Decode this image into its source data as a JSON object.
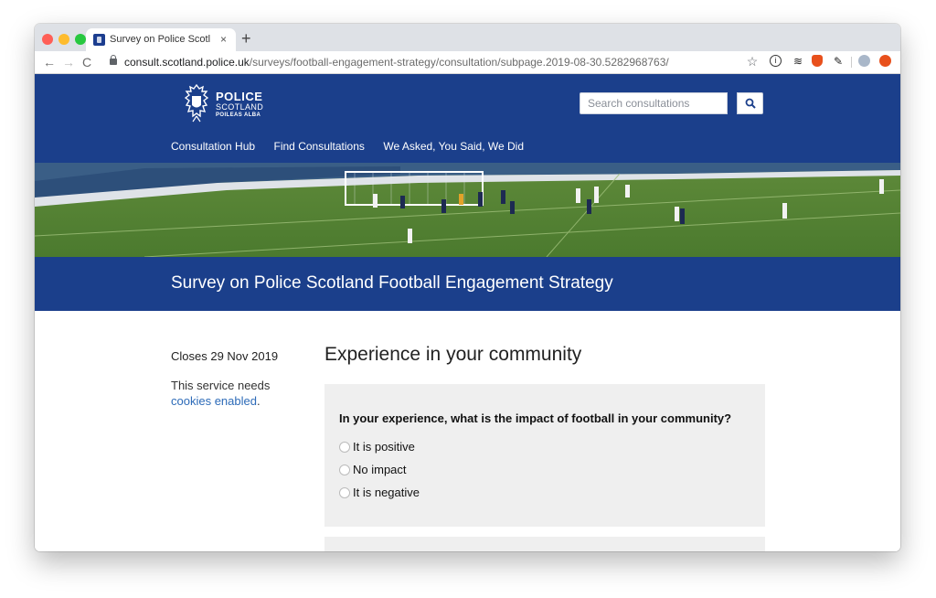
{
  "browser": {
    "tab_title": "Survey on Police Scotland Foot",
    "tab_close": "×",
    "new_tab": "+",
    "url_host": "consult.scotland.police.uk",
    "url_path": "/surveys/football-engagement-strategy/consultation/subpage.2019-08-30.5282968763/",
    "nav": {
      "back": "←",
      "forward": "→",
      "reload": "C"
    },
    "extensions": [
      "star-icon",
      "info-icon",
      "layers-icon",
      "shield-icon",
      "puzzle-icon",
      "avatar-icon",
      "record-icon"
    ]
  },
  "header": {
    "logo": {
      "line1": "POLICE",
      "line2": "SCOTLAND",
      "line3": "POILEAS ALBA"
    },
    "search_placeholder": "Search consultations",
    "nav": [
      "Consultation Hub",
      "Find Consultations",
      "We Asked, You Said, We Did"
    ],
    "brand_color": "#1b3f8b"
  },
  "banner": {
    "title": "Survey on Police Scotland Football Engagement Strategy"
  },
  "sidebar": {
    "closes": "Closes 29 Nov 2019",
    "cookie_text": "This service needs",
    "cookie_link": "cookies enabled",
    "cookie_end": "."
  },
  "main": {
    "section_title": "Experience in your community",
    "question": "In your experience, what is the impact of football in your community?",
    "options": [
      "It is positive",
      "No impact",
      "It is negative"
    ]
  }
}
